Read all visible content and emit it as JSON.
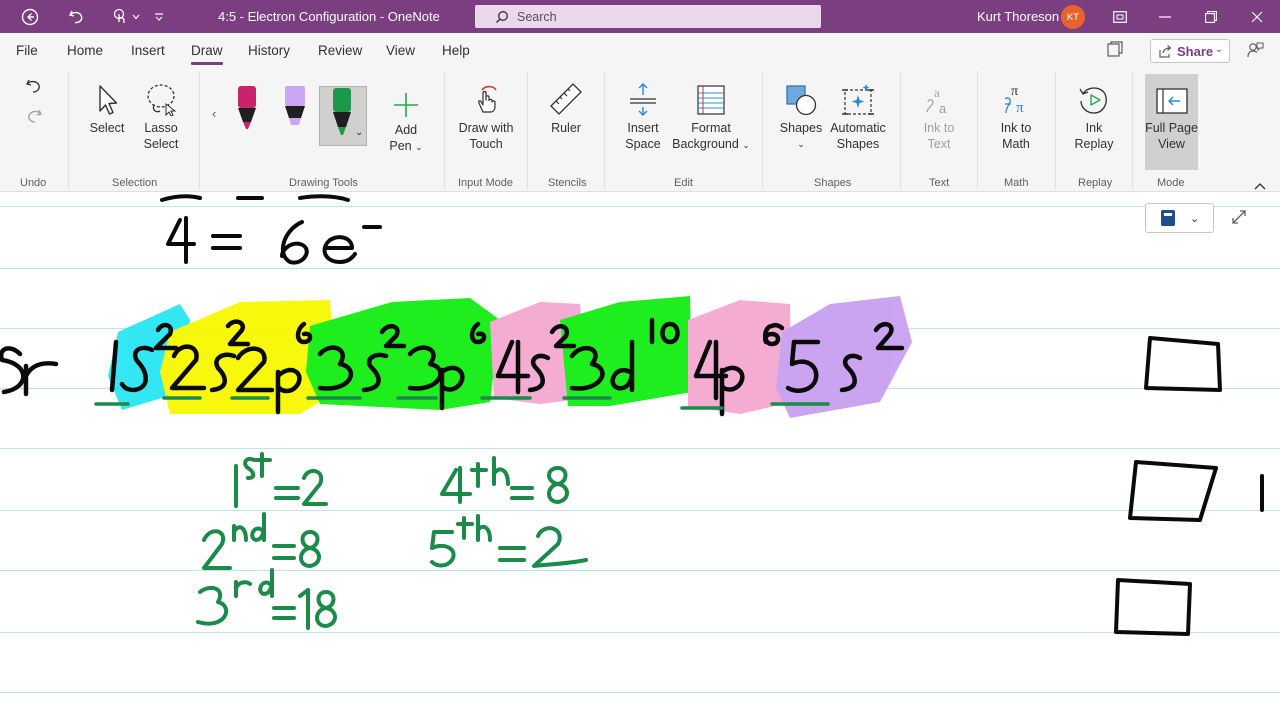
{
  "titlebar": {
    "document_title": "4:5 - Electron Configuration  -  OneNote",
    "search_placeholder": "Search",
    "user_name": "Kurt Thoreson",
    "user_initials": "KT",
    "accent_color": "#7b3e80"
  },
  "menu": {
    "tabs": [
      "File",
      "Home",
      "Insert",
      "Draw",
      "History",
      "Review",
      "View",
      "Help"
    ],
    "active_tab": "Draw",
    "share_label": "Share"
  },
  "ribbon": {
    "undo": {
      "group_label": "Undo"
    },
    "selection": {
      "select": "Select",
      "lasso_line1": "Lasso",
      "lasso_line2": "Select",
      "group_label": "Selection"
    },
    "drawing_tools": {
      "add_pen_line1": "Add",
      "add_pen_line2": "Pen",
      "group_label": "Drawing Tools",
      "pens": [
        "magenta-pen",
        "lavender-highlighter",
        "green-pen-selected"
      ]
    },
    "input_mode": {
      "draw_touch_line1": "Draw with",
      "draw_touch_line2": "Touch",
      "group_label": "Input Mode"
    },
    "stencils": {
      "ruler": "Ruler",
      "group_label": "Stencils"
    },
    "edit": {
      "insert_space_line1": "Insert",
      "insert_space_line2": "Space",
      "format_bg_line1": "Format",
      "format_bg_line2": "Background",
      "group_label": "Edit"
    },
    "shapes": {
      "shapes": "Shapes",
      "auto_line1": "Automatic",
      "auto_line2": "Shapes",
      "group_label": "Shapes"
    },
    "text": {
      "ink_text_line1": "Ink to",
      "ink_text_line2": "Text",
      "group_label": "Text"
    },
    "math": {
      "ink_math_line1": "Ink to",
      "ink_math_line2": "Math",
      "group_label": "Math"
    },
    "replay": {
      "ink_replay_line1": "Ink",
      "ink_replay_line2": "Replay",
      "group_label": "Replay"
    },
    "mode": {
      "full_page_line1": "Full Page",
      "full_page_line2": "View",
      "group_label": "Mode"
    }
  },
  "canvas": {
    "handwritten": {
      "partial_line": "4 = 6e⁻",
      "configuration": [
        "1s²",
        "2s²",
        "2p⁶",
        "3s²",
        "3p⁶",
        "4s²",
        "3d¹⁰",
        "4p⁶",
        "5s²"
      ],
      "element_fragment": "Sr",
      "shells": [
        "1st = 2",
        "2nd = 8",
        "3rd = 18",
        "4th = 8",
        "5th = 2"
      ]
    },
    "highlight_colors": {
      "cyan": "#29e6f2",
      "yellow": "#f8f800",
      "green": "#12ee12",
      "pink": "#f4a8d0",
      "lavender": "#c8a0f0",
      "ink_black": "#0a0a0a",
      "ink_green": "#1c8a48"
    }
  }
}
